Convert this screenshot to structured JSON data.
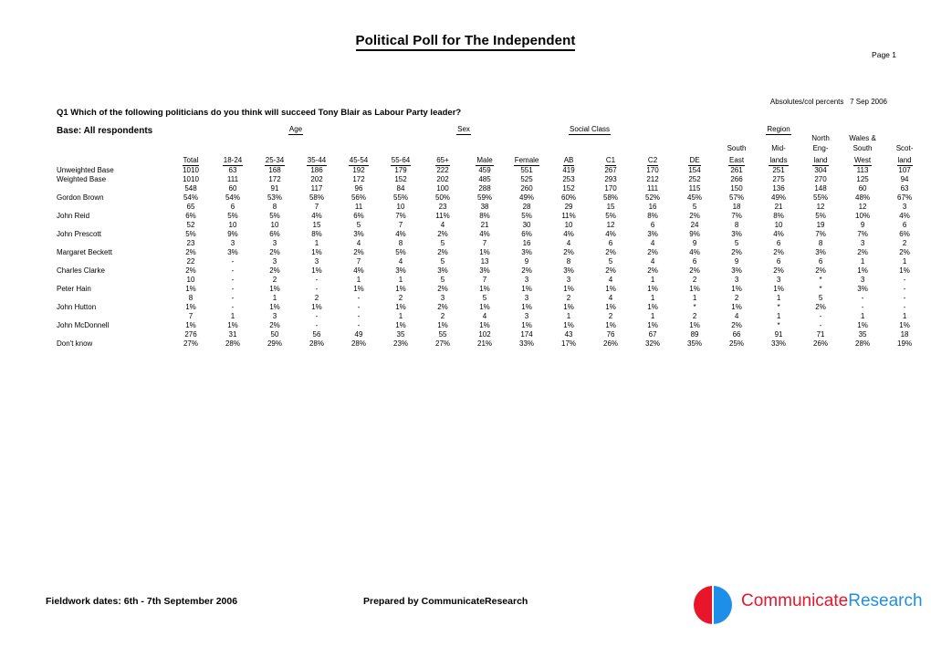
{
  "header": {
    "title": "Political Poll for The Independent",
    "page_number": "Page 1",
    "absolutes_note": "Absolutes/col percents   7 Sep 2006",
    "question": "Q1 Which of the following politicians do you think will succeed Tony Blair as Labour Party leader?",
    "base_label": "Base: All respondents"
  },
  "column_groups": [
    {
      "label": "",
      "span": 1
    },
    {
      "label": "Age",
      "span": 6
    },
    {
      "label": "Sex",
      "span": 2
    },
    {
      "label": "Social Class",
      "span": 4
    },
    {
      "label": "Region",
      "span": 5
    }
  ],
  "columns": [
    {
      "id": "total",
      "line1": "",
      "line2": "",
      "line3": "Total"
    },
    {
      "id": "age1824",
      "line1": "",
      "line2": "",
      "line3": "18-24"
    },
    {
      "id": "age2534",
      "line1": "",
      "line2": "",
      "line3": "25-34"
    },
    {
      "id": "age3544",
      "line1": "",
      "line2": "",
      "line3": "35-44"
    },
    {
      "id": "age4554",
      "line1": "",
      "line2": "",
      "line3": "45-54"
    },
    {
      "id": "age5564",
      "line1": "",
      "line2": "",
      "line3": "55-64"
    },
    {
      "id": "age65plus",
      "line1": "",
      "line2": "",
      "line3": "65+"
    },
    {
      "id": "male",
      "line1": "",
      "line2": "",
      "line3": "Male"
    },
    {
      "id": "female",
      "line1": "",
      "line2": "",
      "line3": "Female"
    },
    {
      "id": "ab",
      "line1": "",
      "line2": "",
      "line3": "AB"
    },
    {
      "id": "c1",
      "line1": "",
      "line2": "",
      "line3": "C1"
    },
    {
      "id": "c2",
      "line1": "",
      "line2": "",
      "line3": "C2"
    },
    {
      "id": "de",
      "line1": "",
      "line2": "",
      "line3": "DE"
    },
    {
      "id": "southeast",
      "line1": "",
      "line2": "South",
      "line3": "East"
    },
    {
      "id": "midlands",
      "line1": "",
      "line2": "Mid-",
      "line3": "lands"
    },
    {
      "id": "northeng",
      "line1": "North",
      "line2": "Eng-",
      "line3": "land"
    },
    {
      "id": "walessw",
      "line1": "Wales &",
      "line2": "South",
      "line3": "West"
    },
    {
      "id": "scotland",
      "line1": "",
      "line2": "Scot-",
      "line3": "land"
    }
  ],
  "rows": [
    {
      "label": "Unweighted Base",
      "type": "base",
      "counts": [
        "1010",
        "63",
        "168",
        "186",
        "192",
        "179",
        "222",
        "459",
        "551",
        "419",
        "267",
        "170",
        "154",
        "261",
        "251",
        "304",
        "113",
        "107"
      ],
      "percents": []
    },
    {
      "label": "Weighted Base",
      "type": "base",
      "counts": [
        "1010",
        "111",
        "172",
        "202",
        "172",
        "152",
        "202",
        "485",
        "525",
        "253",
        "293",
        "212",
        "252",
        "266",
        "275",
        "270",
        "125",
        "94"
      ],
      "percents": []
    },
    {
      "label": "Gordon Brown",
      "type": "data",
      "counts": [
        "548",
        "60",
        "91",
        "117",
        "96",
        "84",
        "100",
        "288",
        "260",
        "152",
        "170",
        "111",
        "115",
        "150",
        "136",
        "148",
        "60",
        "63"
      ],
      "percents": [
        "54%",
        "54%",
        "53%",
        "58%",
        "56%",
        "55%",
        "50%",
        "59%",
        "49%",
        "60%",
        "58%",
        "52%",
        "45%",
        "57%",
        "49%",
        "55%",
        "48%",
        "67%"
      ]
    },
    {
      "label": "John Reid",
      "type": "data",
      "counts": [
        "65",
        "6",
        "8",
        "7",
        "11",
        "10",
        "23",
        "38",
        "28",
        "29",
        "15",
        "16",
        "5",
        "18",
        "21",
        "12",
        "12",
        "3"
      ],
      "percents": [
        "6%",
        "5%",
        "5%",
        "4%",
        "6%",
        "7%",
        "11%",
        "8%",
        "5%",
        "11%",
        "5%",
        "8%",
        "2%",
        "7%",
        "8%",
        "5%",
        "10%",
        "4%"
      ]
    },
    {
      "label": "John Prescott",
      "type": "data",
      "counts": [
        "52",
        "10",
        "10",
        "15",
        "5",
        "7",
        "4",
        "21",
        "30",
        "10",
        "12",
        "6",
        "24",
        "8",
        "10",
        "19",
        "9",
        "6"
      ],
      "percents": [
        "5%",
        "9%",
        "6%",
        "8%",
        "3%",
        "4%",
        "2%",
        "4%",
        "6%",
        "4%",
        "4%",
        "3%",
        "9%",
        "3%",
        "4%",
        "7%",
        "7%",
        "6%"
      ]
    },
    {
      "label": "Margaret Beckett",
      "type": "data",
      "counts": [
        "23",
        "3",
        "3",
        "1",
        "4",
        "8",
        "5",
        "7",
        "16",
        "4",
        "6",
        "4",
        "9",
        "5",
        "6",
        "8",
        "3",
        "2"
      ],
      "percents": [
        "2%",
        "3%",
        "2%",
        "1%",
        "2%",
        "5%",
        "2%",
        "1%",
        "3%",
        "2%",
        "2%",
        "2%",
        "4%",
        "2%",
        "2%",
        "3%",
        "2%",
        "2%"
      ]
    },
    {
      "label": "Charles Clarke",
      "type": "data",
      "counts": [
        "22",
        "-",
        "3",
        "3",
        "7",
        "4",
        "5",
        "13",
        "9",
        "8",
        "5",
        "4",
        "6",
        "9",
        "6",
        "6",
        "1",
        "1"
      ],
      "percents": [
        "2%",
        "-",
        "2%",
        "1%",
        "4%",
        "3%",
        "3%",
        "3%",
        "2%",
        "3%",
        "2%",
        "2%",
        "2%",
        "3%",
        "2%",
        "2%",
        "1%",
        "1%"
      ]
    },
    {
      "label": "Peter Hain",
      "type": "data",
      "counts": [
        "10",
        "-",
        "2",
        "-",
        "1",
        "1",
        "5",
        "7",
        "3",
        "3",
        "4",
        "1",
        "2",
        "3",
        "3",
        "*",
        "3",
        "-"
      ],
      "percents": [
        "1%",
        "-",
        "1%",
        "-",
        "1%",
        "1%",
        "2%",
        "1%",
        "1%",
        "1%",
        "1%",
        "1%",
        "1%",
        "1%",
        "1%",
        "*",
        "3%",
        "-"
      ]
    },
    {
      "label": "John Hutton",
      "type": "data",
      "counts": [
        "8",
        "-",
        "1",
        "2",
        "-",
        "2",
        "3",
        "5",
        "3",
        "2",
        "4",
        "1",
        "1",
        "2",
        "1",
        "5",
        "-",
        "-"
      ],
      "percents": [
        "1%",
        "-",
        "1%",
        "1%",
        "-",
        "1%",
        "2%",
        "1%",
        "1%",
        "1%",
        "1%",
        "1%",
        "*",
        "1%",
        "*",
        "2%",
        "-",
        "-"
      ]
    },
    {
      "label": "John McDonnell",
      "type": "data",
      "counts": [
        "7",
        "1",
        "3",
        "-",
        "-",
        "1",
        "2",
        "4",
        "3",
        "1",
        "2",
        "1",
        "2",
        "4",
        "1",
        "-",
        "1",
        "1"
      ],
      "percents": [
        "1%",
        "1%",
        "2%",
        "-",
        "-",
        "1%",
        "1%",
        "1%",
        "1%",
        "1%",
        "1%",
        "1%",
        "1%",
        "2%",
        "*",
        "-",
        "1%",
        "1%"
      ]
    },
    {
      "label": "Don't know",
      "type": "data",
      "counts": [
        "276",
        "31",
        "50",
        "56",
        "49",
        "35",
        "55",
        "102",
        "174",
        "43",
        "76",
        "67",
        "89",
        "66",
        "91",
        "71",
        "35",
        "18"
      ],
      "percents": [
        "27%",
        "28%",
        "29%",
        "28%",
        "28%",
        "23%",
        "27%",
        "21%",
        "33%",
        "17%",
        "26%",
        "32%",
        "35%",
        "25%",
        "33%",
        "26%",
        "28%",
        "19%"
      ]
    }
  ],
  "footer": {
    "fieldwork": "Fieldwork dates: 6th - 7th September 2006",
    "prepared_by": "Prepared by CommunicateResearch",
    "logo_word_1": "Communicate",
    "logo_word_2": "Research"
  }
}
